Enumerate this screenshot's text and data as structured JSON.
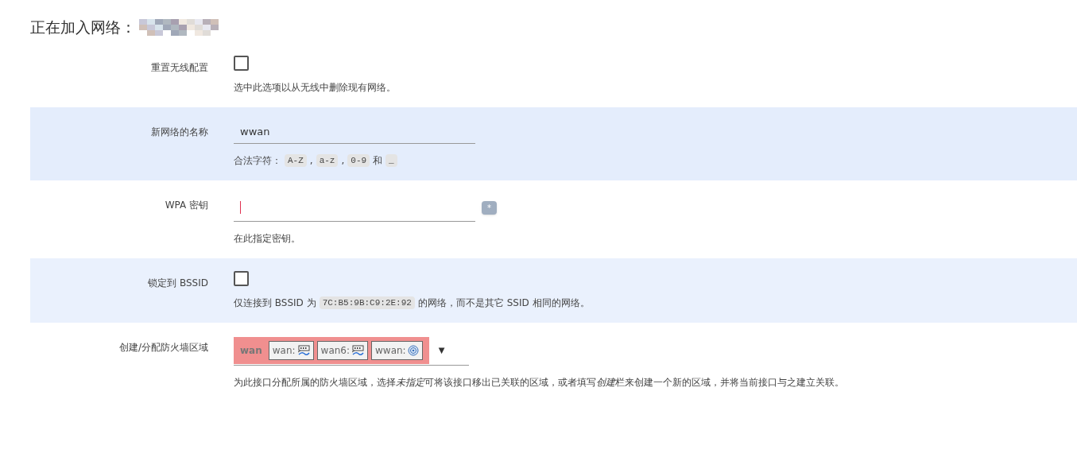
{
  "title": "正在加入网络：",
  "rows": [
    {
      "kind": "checkbox",
      "label": "重置无线配置",
      "checked": false,
      "hint": [
        {
          "text": "选中此选项以从无线中删除现有网络。",
          "kind": "plain"
        }
      ]
    },
    {
      "kind": "text",
      "label": "新网络的名称",
      "value": "wwan",
      "hint": [
        {
          "text": "合法字符：",
          "kind": "plain"
        },
        {
          "text": "A-Z",
          "kind": "code"
        },
        {
          "text": ",",
          "kind": "plain"
        },
        {
          "text": "a-z",
          "kind": "code"
        },
        {
          "text": ",",
          "kind": "plain"
        },
        {
          "text": "0-9",
          "kind": "code"
        },
        {
          "text": "和",
          "kind": "plain"
        },
        {
          "text": "_",
          "kind": "code"
        }
      ]
    },
    {
      "kind": "password",
      "label": "WPA 密钥",
      "value": "",
      "reveal": "*",
      "hint": [
        {
          "text": "在此指定密钥。",
          "kind": "plain"
        }
      ]
    },
    {
      "kind": "checkbox",
      "label": "锁定到 BSSID",
      "checked": false,
      "hint": [
        {
          "text": "仅连接到 BSSID 为",
          "kind": "plain"
        },
        {
          "text": "7C:B5:9B:C9:2E:92",
          "kind": "code"
        },
        {
          "text": "的网络，而不是其它 SSID 相同的网络。",
          "kind": "plain"
        }
      ]
    },
    {
      "kind": "zone",
      "label": "创建/分配防火墙区域",
      "zone": {
        "name": "wan",
        "color": "#f08f8f",
        "devices": [
          {
            "name": "wan:",
            "kind": "ethernet"
          },
          {
            "name": "wan6:",
            "kind": "ethernet"
          },
          {
            "name": "wwan:",
            "kind": "wifi"
          }
        ]
      },
      "caret": "▼",
      "hint": [
        {
          "kind": "sentence",
          "segments": [
            {
              "text": "为此接口分配所属的防火墙区域，选择",
              "italic": false
            },
            {
              "text": "未指定",
              "italic": true
            },
            {
              "text": "可将该接口移出已关联的区域，或者填写",
              "italic": false
            },
            {
              "text": "创建",
              "italic": true
            },
            {
              "text": "栏来创建一个新的区域，并将当前接口与之建立关联。",
              "italic": false
            }
          ]
        }
      ]
    }
  ]
}
